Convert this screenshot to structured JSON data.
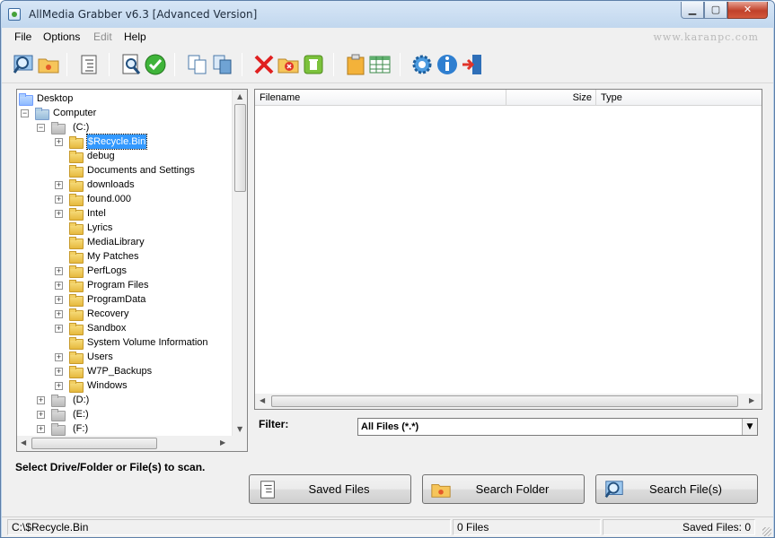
{
  "window": {
    "title": "AllMedia Grabber v6.3 [Advanced Version]"
  },
  "menu": {
    "file": "File",
    "options": "Options",
    "edit": "Edit",
    "help": "Help",
    "watermark": "www.karanpc.com"
  },
  "toolbar": {
    "icons": [
      "search-icon",
      "open-folder-icon",
      "list-icon",
      "find-icon",
      "check-icon",
      "copy-icon",
      "copy-multiple-icon",
      "delete-icon",
      "remove-folder-icon",
      "trash-icon",
      "clipboard-icon",
      "table-icon",
      "settings-icon",
      "info-icon",
      "exit-icon"
    ]
  },
  "tree": {
    "desktop": "Desktop",
    "computer": "Computer",
    "c_drive": "(C:)",
    "folders": [
      "$Recycle.Bin",
      "debug",
      "Documents and Settings",
      "downloads",
      "found.000",
      "Intel",
      "Lyrics",
      "MediaLibrary",
      "My Patches",
      "PerfLogs",
      "Program Files",
      "ProgramData",
      "Recovery",
      "Sandbox",
      "System Volume Information",
      "Users",
      "W7P_Backups",
      "Windows"
    ],
    "expandable": [
      true,
      false,
      false,
      true,
      true,
      true,
      false,
      false,
      false,
      true,
      true,
      true,
      true,
      true,
      false,
      true,
      true,
      true
    ],
    "selected": "$Recycle.Bin",
    "drives": [
      "(D:)",
      "(E:)",
      "(F:)"
    ]
  },
  "filelist": {
    "columns": {
      "filename": "Filename",
      "size": "Size",
      "type": "Type"
    }
  },
  "filter": {
    "label": "Filter:",
    "value": "All Files (*.*)"
  },
  "instruction": "Select Drive/Folder or File(s) to scan.",
  "buttons": {
    "saved_files": "Saved Files",
    "search_folder": "Search Folder",
    "search_files": "Search File(s)"
  },
  "status": {
    "path": "C:\\$Recycle.Bin",
    "files": "0 Files",
    "saved": "Saved Files: 0"
  }
}
